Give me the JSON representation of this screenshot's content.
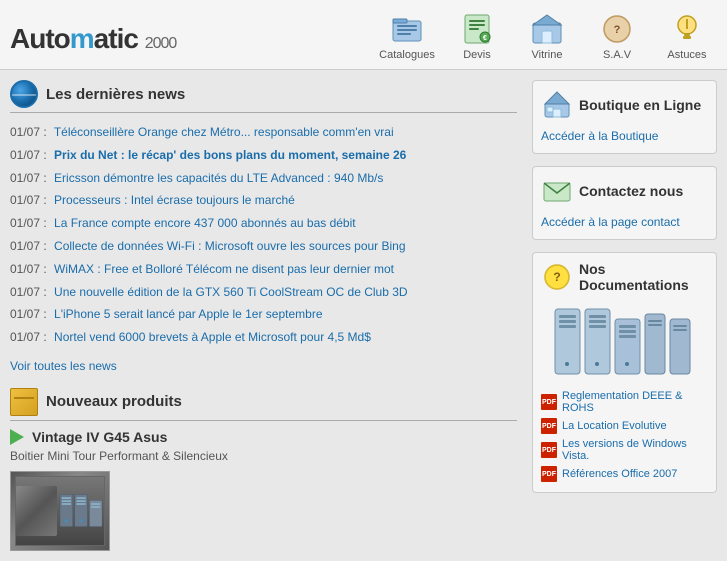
{
  "header": {
    "logo": {
      "prefix": "Auto",
      "highlight": "m",
      "suffix": "atic",
      "year": "2000"
    },
    "nav": [
      {
        "label": "Catalogues",
        "icon": "catalogue-icon"
      },
      {
        "label": "Devis",
        "icon": "devis-icon"
      },
      {
        "label": "Vitrine",
        "icon": "vitrine-icon"
      },
      {
        "label": "S.A.V",
        "icon": "sav-icon"
      },
      {
        "label": "Astuces",
        "icon": "astuces-icon"
      }
    ]
  },
  "news": {
    "section_title": "Les dernières news",
    "items": [
      {
        "date": "01/07 :",
        "text": "Téléconseillère Orange chez Métro... responsable comm'en vrai",
        "bold": false
      },
      {
        "date": "01/07 :",
        "text": "Prix du Net : le récap' des bons plans du moment, semaine 26",
        "bold": true
      },
      {
        "date": "01/07 :",
        "text": "Ericsson démontre les capacités du LTE Advanced : 940 Mb/s",
        "bold": false
      },
      {
        "date": "01/07 :",
        "text": "Processeurs : Intel écrase toujours le marché",
        "bold": false
      },
      {
        "date": "01/07 :",
        "text": "La France compte encore 437 000 abonnés au bas débit",
        "bold": false
      },
      {
        "date": "01/07 :",
        "text": "Collecte de données Wi-Fi : Microsoft ouvre les sources pour Bing",
        "bold": false
      },
      {
        "date": "01/07 :",
        "text": "WiMAX : Free et Bolloré Télécom ne disent pas leur dernier mot",
        "bold": false
      },
      {
        "date": "01/07 :",
        "text": "Une nouvelle édition de la GTX 560 Ti CoolStream OC de Club 3D",
        "bold": false
      },
      {
        "date": "01/07 :",
        "text": "L'iPhone 5 serait lancé par Apple le 1er septembre",
        "bold": false
      },
      {
        "date": "01/07 :",
        "text": "Nortel vend 6000 brevets à Apple et Microsoft pour 4,5 Md$",
        "bold": false
      }
    ],
    "see_all": "Voir toutes les news"
  },
  "produits": {
    "section_title": "Nouveaux produits",
    "product_name": "Vintage IV G45 Asus",
    "product_desc": "Boitier Mini Tour Performant & Silencieux"
  },
  "right": {
    "boutique": {
      "title": "Boutique en Ligne",
      "link": "Accéder à la Boutique"
    },
    "contact": {
      "title": "Contactez nous",
      "link": "Accéder à la page contact"
    },
    "docs": {
      "title": "Nos Documentations",
      "items": [
        "Reglementation DEEE & ROHS",
        "La Location Evolutive",
        "Les versions de Windows Vista.",
        "Références Office 2007"
      ]
    }
  }
}
